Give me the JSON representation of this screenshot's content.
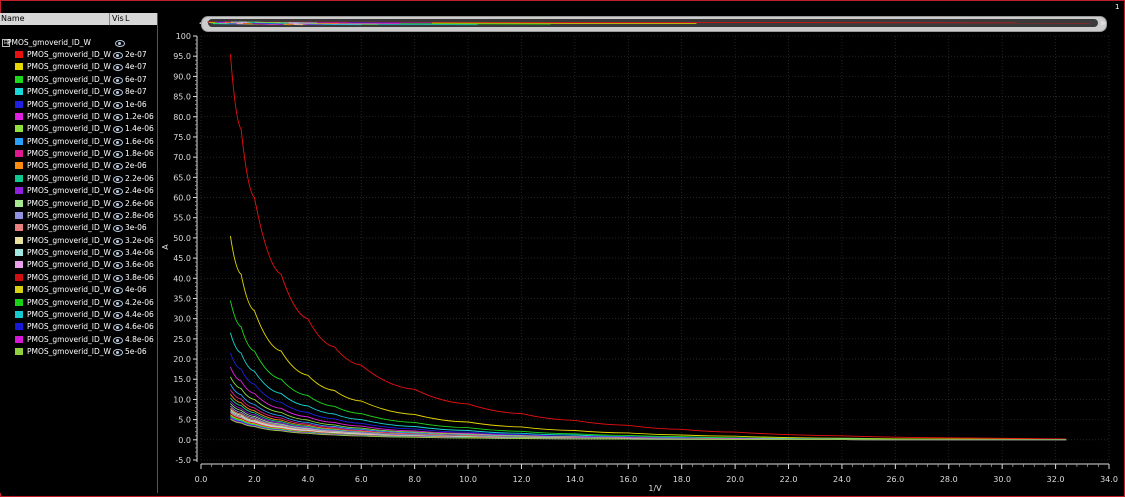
{
  "panel": {
    "header": {
      "name": "Name",
      "vis": "Vis",
      "l": "L"
    },
    "group_name": "PMOS_gmoverid_ID_W",
    "group_expander": "⊟",
    "corner_label": "1",
    "items": [
      {
        "name": "PMOS_gmoverid_ID_W",
        "l": "2e-07",
        "color": "#e81010"
      },
      {
        "name": "PMOS_gmoverid_ID_W",
        "l": "4e-07",
        "color": "#e6d800"
      },
      {
        "name": "PMOS_gmoverid_ID_W",
        "l": "6e-07",
        "color": "#1ed81e"
      },
      {
        "name": "PMOS_gmoverid_ID_W",
        "l": "8e-07",
        "color": "#18d8d8"
      },
      {
        "name": "PMOS_gmoverid_ID_W",
        "l": "1e-06",
        "color": "#2020e0"
      },
      {
        "name": "PMOS_gmoverid_ID_W",
        "l": "1.2e-06",
        "color": "#e020e0"
      },
      {
        "name": "PMOS_gmoverid_ID_W",
        "l": "1.4e-06",
        "color": "#90e040"
      },
      {
        "name": "PMOS_gmoverid_ID_W",
        "l": "1.6e-06",
        "color": "#2aa0ff"
      },
      {
        "name": "PMOS_gmoverid_ID_W",
        "l": "1.8e-06",
        "color": "#e01890"
      },
      {
        "name": "PMOS_gmoverid_ID_W",
        "l": "2e-06",
        "color": "#ff8c10"
      },
      {
        "name": "PMOS_gmoverid_ID_W",
        "l": "2.2e-06",
        "color": "#10c890"
      },
      {
        "name": "PMOS_gmoverid_ID_W",
        "l": "2.4e-06",
        "color": "#9020e0"
      },
      {
        "name": "PMOS_gmoverid_ID_W",
        "l": "2.6e-06",
        "color": "#a8e890"
      },
      {
        "name": "PMOS_gmoverid_ID_W",
        "l": "2.8e-06",
        "color": "#9090e0"
      },
      {
        "name": "PMOS_gmoverid_ID_W",
        "l": "3e-06",
        "color": "#e88080"
      },
      {
        "name": "PMOS_gmoverid_ID_W",
        "l": "3.2e-06",
        "color": "#e8e0a0"
      },
      {
        "name": "PMOS_gmoverid_ID_W",
        "l": "3.4e-06",
        "color": "#a0e8e0"
      },
      {
        "name": "PMOS_gmoverid_ID_W",
        "l": "3.6e-06",
        "color": "#e8a0e8"
      },
      {
        "name": "PMOS_gmoverid_ID_W",
        "l": "3.8e-06",
        "color": "#d01010"
      },
      {
        "name": "PMOS_gmoverid_ID_W",
        "l": "4e-06",
        "color": "#d8d010"
      },
      {
        "name": "PMOS_gmoverid_ID_W",
        "l": "4.2e-06",
        "color": "#18d018"
      },
      {
        "name": "PMOS_gmoverid_ID_W",
        "l": "4.4e-06",
        "color": "#18c8d0"
      },
      {
        "name": "PMOS_gmoverid_ID_W",
        "l": "4.6e-06",
        "color": "#1818d8"
      },
      {
        "name": "PMOS_gmoverid_ID_W",
        "l": "4.8e-06",
        "color": "#d818d8"
      },
      {
        "name": "PMOS_gmoverid_ID_W",
        "l": "5e-06",
        "color": "#90d040"
      }
    ]
  },
  "chart_data": {
    "type": "line",
    "title": "",
    "xlabel": "1/V",
    "ylabel": "A",
    "xlim": [
      0.0,
      34.0
    ],
    "ylim": [
      -5.0,
      100
    ],
    "xticks": [
      "0.0",
      "2.0",
      "4.0",
      "6.0",
      "8.0",
      "10.0",
      "12.0",
      "14.0",
      "16.0",
      "18.0",
      "20.0",
      "22.0",
      "24.0",
      "26.0",
      "28.0",
      "30.0",
      "32.0",
      "34.0"
    ],
    "xtick_values": [
      0,
      2,
      4,
      6,
      8,
      10,
      12,
      14,
      16,
      18,
      20,
      22,
      24,
      26,
      28,
      30,
      32,
      34
    ],
    "yticks": [
      "-5.0",
      "0.0",
      "5.0",
      "10.0",
      "15.0",
      "20.0",
      "25.0",
      "30.0",
      "35.0",
      "40.0",
      "45.0",
      "50.0",
      "55.0",
      "60.0",
      "65.0",
      "70.0",
      "75.0",
      "80.0",
      "85.0",
      "90.0",
      "95.0",
      "100"
    ],
    "ytick_values": [
      -5,
      0,
      5,
      10,
      15,
      20,
      25,
      30,
      35,
      40,
      45,
      50,
      55,
      60,
      65,
      70,
      75,
      80,
      85,
      90,
      95,
      100
    ],
    "grid": true,
    "x": [
      1.1,
      1.5,
      2.0,
      3.0,
      4.0,
      5.0,
      6.0,
      8.0,
      10.0,
      12.0,
      14.0,
      16.0,
      18.0,
      20.0,
      24.0,
      28.0,
      32.4
    ],
    "series": [
      {
        "name": "2e-07",
        "values": [
          95.5,
          77,
          60,
          41,
          30,
          23,
          18.5,
          12.5,
          8.9,
          6.5,
          4.8,
          3.6,
          2.6,
          1.9,
          1.0,
          0.5,
          0.2
        ]
      },
      {
        "name": "4e-07",
        "values": [
          50.5,
          41,
          32,
          22,
          16,
          12.2,
          9.6,
          6.3,
          4.4,
          3.2,
          2.3,
          1.7,
          1.2,
          0.9,
          0.4,
          0.2,
          0.05
        ]
      },
      {
        "name": "6e-07",
        "values": [
          34.5,
          28,
          22,
          15,
          11,
          8.3,
          6.5,
          4.3,
          3.0,
          2.1,
          1.5,
          1.1,
          0.8,
          0.5,
          0.2,
          0.1,
          0.0
        ]
      },
      {
        "name": "8e-07",
        "values": [
          26.5,
          21.5,
          17,
          11.5,
          8.4,
          6.4,
          5.0,
          3.3,
          2.3,
          1.6,
          1.2,
          0.8,
          0.6,
          0.4,
          0.2,
          0.05,
          0.0
        ]
      },
      {
        "name": "1e-06",
        "values": [
          21.5,
          17.5,
          13.8,
          9.3,
          6.8,
          5.2,
          4.1,
          2.7,
          1.9,
          1.3,
          0.9,
          0.7,
          0.5,
          0.3,
          0.1,
          0.0,
          0.0
        ]
      },
      {
        "name": "1.2e-06",
        "values": [
          18,
          14.6,
          11.5,
          7.8,
          5.7,
          4.3,
          3.4,
          2.2,
          1.6,
          1.1,
          0.8,
          0.6,
          0.4,
          0.3,
          0.1,
          0.0,
          0.0
        ]
      },
      {
        "name": "1.4e-06",
        "values": [
          15.6,
          12.7,
          10,
          6.8,
          4.9,
          3.7,
          2.9,
          1.9,
          1.4,
          1.0,
          0.7,
          0.5,
          0.35,
          0.2,
          0.1,
          0.0,
          0.0
        ]
      },
      {
        "name": "1.6e-06",
        "values": [
          13.8,
          11.2,
          8.8,
          6.0,
          4.3,
          3.3,
          2.6,
          1.7,
          1.2,
          0.85,
          0.6,
          0.45,
          0.3,
          0.2,
          0.1,
          0.0,
          0.0
        ]
      },
      {
        "name": "1.8e-06",
        "values": [
          12.4,
          10.1,
          7.9,
          5.4,
          3.9,
          3.0,
          2.3,
          1.5,
          1.1,
          0.75,
          0.55,
          0.4,
          0.3,
          0.2,
          0.1,
          0.0,
          0.0
        ]
      },
      {
        "name": "2e-06",
        "values": [
          11.3,
          9.2,
          7.2,
          4.9,
          3.6,
          2.7,
          2.1,
          1.4,
          1.0,
          0.7,
          0.5,
          0.37,
          0.27,
          0.2,
          0.1,
          0.0,
          0.0
        ]
      },
      {
        "name": "2.2e-06",
        "values": [
          10.4,
          8.5,
          6.7,
          4.5,
          3.3,
          2.5,
          1.95,
          1.3,
          0.9,
          0.65,
          0.47,
          0.34,
          0.25,
          0.18,
          0.08,
          0.0,
          0.0
        ]
      },
      {
        "name": "2.4e-06",
        "values": [
          9.6,
          7.8,
          6.2,
          4.2,
          3.05,
          2.3,
          1.8,
          1.2,
          0.85,
          0.6,
          0.44,
          0.32,
          0.23,
          0.17,
          0.07,
          0.0,
          0.0
        ]
      },
      {
        "name": "2.6e-06",
        "values": [
          9.0,
          7.3,
          5.8,
          3.9,
          2.85,
          2.15,
          1.7,
          1.12,
          0.8,
          0.56,
          0.41,
          0.3,
          0.22,
          0.16,
          0.07,
          0.0,
          0.0
        ]
      },
      {
        "name": "2.8e-06",
        "values": [
          8.4,
          6.8,
          5.4,
          3.65,
          2.65,
          2.0,
          1.6,
          1.05,
          0.75,
          0.53,
          0.38,
          0.28,
          0.2,
          0.15,
          0.06,
          0.0,
          0.0
        ]
      },
      {
        "name": "3e-06",
        "values": [
          7.9,
          6.4,
          5.1,
          3.45,
          2.5,
          1.9,
          1.5,
          0.98,
          0.7,
          0.5,
          0.36,
          0.26,
          0.19,
          0.14,
          0.06,
          0.0,
          0.0
        ]
      },
      {
        "name": "3.2e-06",
        "values": [
          7.5,
          6.1,
          4.8,
          3.25,
          2.37,
          1.8,
          1.42,
          0.93,
          0.66,
          0.47,
          0.34,
          0.25,
          0.18,
          0.13,
          0.06,
          0.0,
          0.0
        ]
      },
      {
        "name": "3.4e-06",
        "values": [
          7.1,
          5.8,
          4.55,
          3.1,
          2.25,
          1.7,
          1.35,
          0.88,
          0.63,
          0.45,
          0.32,
          0.24,
          0.17,
          0.12,
          0.05,
          0.0,
          0.0
        ]
      },
      {
        "name": "3.6e-06",
        "values": [
          6.8,
          5.5,
          4.35,
          2.95,
          2.15,
          1.62,
          1.28,
          0.84,
          0.6,
          0.43,
          0.31,
          0.23,
          0.16,
          0.12,
          0.05,
          0.0,
          0.0
        ]
      },
      {
        "name": "3.8e-06",
        "values": [
          6.5,
          5.3,
          4.15,
          2.82,
          2.05,
          1.55,
          1.22,
          0.8,
          0.57,
          0.41,
          0.29,
          0.22,
          0.16,
          0.11,
          0.05,
          0.0,
          0.0
        ]
      },
      {
        "name": "4e-06",
        "values": [
          6.2,
          5.05,
          3.97,
          2.7,
          1.97,
          1.48,
          1.17,
          0.77,
          0.55,
          0.39,
          0.28,
          0.21,
          0.15,
          0.11,
          0.05,
          0.0,
          0.0
        ]
      },
      {
        "name": "4.2e-06",
        "values": [
          5.95,
          4.85,
          3.8,
          2.58,
          1.88,
          1.42,
          1.12,
          0.74,
          0.53,
          0.37,
          0.27,
          0.2,
          0.14,
          0.1,
          0.04,
          0.0,
          0.0
        ]
      },
      {
        "name": "4.4e-06",
        "values": [
          5.7,
          4.65,
          3.65,
          2.48,
          1.81,
          1.37,
          1.08,
          0.71,
          0.51,
          0.36,
          0.26,
          0.19,
          0.14,
          0.1,
          0.04,
          0.0,
          0.0
        ]
      },
      {
        "name": "4.6e-06",
        "values": [
          5.5,
          4.48,
          3.52,
          2.39,
          1.74,
          1.32,
          1.04,
          0.68,
          0.49,
          0.35,
          0.25,
          0.18,
          0.13,
          0.1,
          0.04,
          0.0,
          0.0
        ]
      },
      {
        "name": "4.8e-06",
        "values": [
          5.3,
          4.32,
          3.4,
          2.3,
          1.68,
          1.27,
          1.0,
          0.66,
          0.47,
          0.34,
          0.24,
          0.18,
          0.13,
          0.09,
          0.04,
          0.0,
          0.0
        ]
      },
      {
        "name": "5e-06",
        "values": [
          5.1,
          4.16,
          3.27,
          2.22,
          1.62,
          1.22,
          0.96,
          0.63,
          0.45,
          0.32,
          0.23,
          0.17,
          0.12,
          0.09,
          0.04,
          0.0,
          0.0
        ]
      }
    ]
  }
}
